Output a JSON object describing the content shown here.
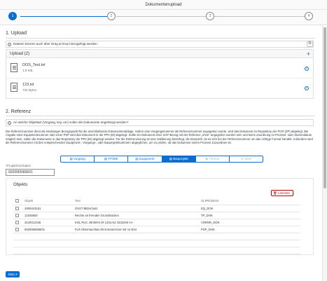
{
  "window": {
    "title": "Dokumentenupload"
  },
  "wizard": {
    "steps": [
      "1",
      "2",
      "3",
      "4"
    ],
    "current": 1
  },
  "upload": {
    "heading": "1. Upload",
    "drag_info": "Dateien können auch über Drag & Drop hinzugefügt werden.",
    "list_title": "Upload (2)",
    "files": [
      {
        "name": "DOS_Text.txt",
        "size": "1,5 KiB"
      },
      {
        "name": "123.txt",
        "size": "732 Bytes"
      }
    ]
  },
  "reference": {
    "heading": "2. Referenz",
    "question": "An welche Objektart (Vorgang, Eqi, etc) sollen die Dokumente angehängt werden?",
    "description": "Die Referenznummer dient als eindeutiger Bezugspunkt für die anschließende Dokumentenablage. Sofern eine Vorgangsnummer als Referenznummer angegeben wurde, wird das Dokument im Repository der PCR (ZP) abgelegt. Bei Angabe einer Equipmentnummer oder einer PSP wird das Dokument in der PPA (M) abgelegt. Sollte ein Dokument ohne SAP-Bezug mit der Referenz „ohne“ angegeben worden sein und keine Zuordnung zu Prozess- oder Stammdatum möglich sein, sollen die Dokumente in das Repository der PPA (M) abgelegt werden. Für die Referenzierung ist eine Validierung hinterlegt, die überprüft, ob es sich bei der Referenznummer um das richtige Format handelt. Außerdem wird die Referenznummer mit den entsprechenden Equipment-, Vorgangs-, oder Bauprojektnummern abgeglichen, um zu prüfen, ob das Dokument einem Prozess zuzuordnen ist.",
    "segments": [
      {
        "label": "Vorgang",
        "icon": "▤",
        "state": "normal"
      },
      {
        "label": "TP/WE",
        "icon": "▤",
        "state": "normal"
      },
      {
        "label": "Equipment",
        "icon": "▤",
        "state": "normal"
      },
      {
        "label": "Bauprojekt",
        "icon": "▤",
        "state": "selected"
      },
      {
        "label": "Partner",
        "icon": "☻",
        "state": "disabled"
      },
      {
        "label": "ohne",
        "icon": "⊘",
        "state": "disabled"
      }
    ],
    "field_label": "*Projekt/Vorhaben",
    "field_value": "6020065968/01"
  },
  "objects": {
    "title": "Objekts",
    "delete_label": "Löschen",
    "columns": [
      "Objekt",
      "Text",
      "GLPROZESS"
    ],
    "rows": [
      [
        "1000423181",
        "OVST Blitzschutz",
        "EQ_DOK"
      ],
      [
        "12345600",
        "Rechte an fremden Grundstücken",
        "TP_DOK"
      ],
      [
        "3120012345",
        "KOL RUC 49/40/04 (R 1201A)4 3432239 AA",
        "VORNR_DOK"
      ],
      [
        "6020065968/01",
        "FLR Obermarchtal Abt-Konrad-Kner-Str 14 E04",
        "PSP_DOK"
      ]
    ]
  },
  "footer": {
    "step_button": "Step 3"
  },
  "colors": {
    "accent": "#0a6ed1",
    "danger": "#bb0000"
  }
}
